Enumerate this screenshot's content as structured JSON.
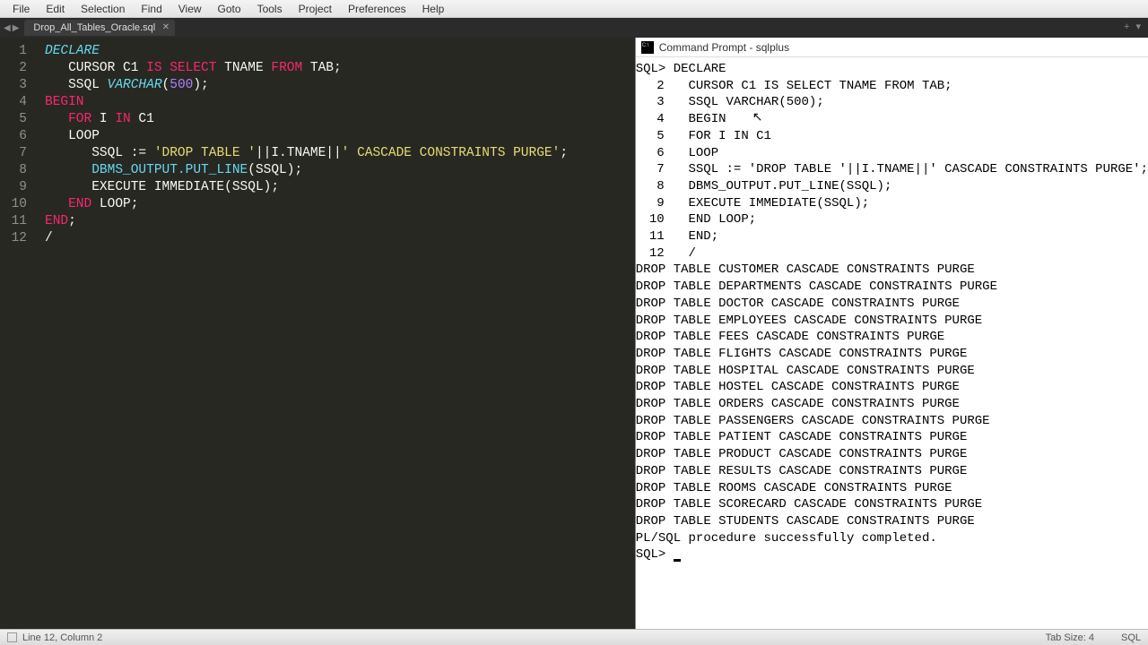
{
  "menu": [
    "File",
    "Edit",
    "Selection",
    "Find",
    "View",
    "Goto",
    "Tools",
    "Project",
    "Preferences",
    "Help"
  ],
  "tab": {
    "name": "Drop_All_Tables_Oracle.sql"
  },
  "editor": {
    "lines": [
      {
        "n": 1,
        "tokens": [
          [
            "kw-cyan",
            "DECLARE"
          ]
        ]
      },
      {
        "n": 2,
        "tokens": [
          [
            "ident",
            "   CURSOR C1 "
          ],
          [
            "kw-red",
            "IS"
          ],
          [
            "ident",
            " "
          ],
          [
            "kw-red",
            "SELECT"
          ],
          [
            "ident",
            " TNAME "
          ],
          [
            "kw-red",
            "FROM"
          ],
          [
            "ident",
            " TAB;"
          ]
        ]
      },
      {
        "n": 3,
        "tokens": [
          [
            "ident",
            "   SSQL "
          ],
          [
            "kw-cyan",
            "VARCHAR"
          ],
          [
            "ident",
            "("
          ],
          [
            "num",
            "500"
          ],
          [
            "ident",
            ");"
          ]
        ]
      },
      {
        "n": 4,
        "tokens": [
          [
            "kw-red",
            "BEGIN"
          ]
        ]
      },
      {
        "n": 5,
        "tokens": [
          [
            "ident",
            "   "
          ],
          [
            "kw-red",
            "FOR"
          ],
          [
            "ident",
            " I "
          ],
          [
            "kw-red",
            "IN"
          ],
          [
            "ident",
            " C1"
          ]
        ]
      },
      {
        "n": 6,
        "tokens": [
          [
            "ident",
            "   LOOP"
          ]
        ]
      },
      {
        "n": 7,
        "tokens": [
          [
            "ident",
            "      SSQL := "
          ],
          [
            "str",
            "'DROP TABLE '"
          ],
          [
            "ident",
            "||I.TNAME||"
          ],
          [
            "str",
            "' CASCADE CONSTRAINTS PURGE'"
          ],
          [
            "ident",
            ";"
          ]
        ]
      },
      {
        "n": 8,
        "tokens": [
          [
            "ident",
            "      "
          ],
          [
            "func",
            "DBMS_OUTPUT.PUT_LINE"
          ],
          [
            "ident",
            "(SSQL);"
          ]
        ]
      },
      {
        "n": 9,
        "tokens": [
          [
            "ident",
            "      EXECUTE IMMEDIATE(SSQL);"
          ]
        ]
      },
      {
        "n": 10,
        "tokens": [
          [
            "ident",
            "   "
          ],
          [
            "kw-red",
            "END"
          ],
          [
            "ident",
            " LOOP;"
          ]
        ]
      },
      {
        "n": 11,
        "tokens": [
          [
            "kw-red",
            "END"
          ],
          [
            "ident",
            ";"
          ]
        ]
      },
      {
        "n": 12,
        "tokens": [
          [
            "ident",
            "/"
          ]
        ]
      }
    ]
  },
  "cmd": {
    "title": "Command Prompt - sqlplus",
    "prompt": "SQL>",
    "script": [
      "DECLARE",
      "CURSOR C1 IS SELECT TNAME FROM TAB;",
      "SSQL VARCHAR(500);",
      "BEGIN",
      "FOR I IN C1",
      "LOOP",
      "SSQL := 'DROP TABLE '||I.TNAME||' CASCADE CONSTRAINTS PURGE';",
      "DBMS_OUTPUT.PUT_LINE(SSQL);",
      "EXECUTE IMMEDIATE(SSQL);",
      "END LOOP;",
      "END;",
      "/"
    ],
    "output": [
      "DROP TABLE CUSTOMER CASCADE CONSTRAINTS PURGE",
      "DROP TABLE DEPARTMENTS CASCADE CONSTRAINTS PURGE",
      "DROP TABLE DOCTOR CASCADE CONSTRAINTS PURGE",
      "DROP TABLE EMPLOYEES CASCADE CONSTRAINTS PURGE",
      "DROP TABLE FEES CASCADE CONSTRAINTS PURGE",
      "DROP TABLE FLIGHTS CASCADE CONSTRAINTS PURGE",
      "DROP TABLE HOSPITAL CASCADE CONSTRAINTS PURGE",
      "DROP TABLE HOSTEL CASCADE CONSTRAINTS PURGE",
      "DROP TABLE ORDERS CASCADE CONSTRAINTS PURGE",
      "DROP TABLE PASSENGERS CASCADE CONSTRAINTS PURGE",
      "DROP TABLE PATIENT CASCADE CONSTRAINTS PURGE",
      "DROP TABLE PRODUCT CASCADE CONSTRAINTS PURGE",
      "DROP TABLE RESULTS CASCADE CONSTRAINTS PURGE",
      "DROP TABLE ROOMS CASCADE CONSTRAINTS PURGE",
      "DROP TABLE SCORECARD CASCADE CONSTRAINTS PURGE",
      "DROP TABLE STUDENTS CASCADE CONSTRAINTS PURGE"
    ],
    "done": "PL/SQL procedure successfully completed."
  },
  "status": {
    "pos": "Line 12, Column 2",
    "tab": "Tab Size: 4",
    "lang": "SQL"
  }
}
